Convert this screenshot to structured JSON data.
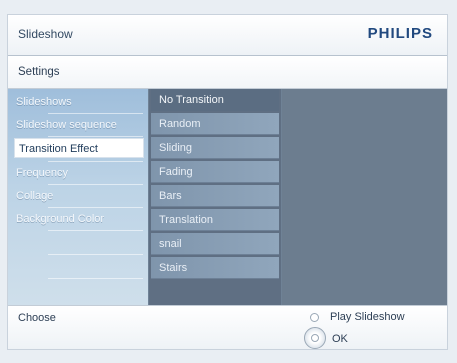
{
  "header": {
    "title": "Slideshow",
    "brand": "PHILIPS"
  },
  "settings": {
    "label": "Settings"
  },
  "menu": {
    "left_items": [
      {
        "label": "Slideshows"
      },
      {
        "label": "Slideshow sequence"
      },
      {
        "label": "Transition Effect",
        "selected": true
      },
      {
        "label": "Frequency"
      },
      {
        "label": "Collage"
      },
      {
        "label": "Background Color"
      }
    ],
    "transitions": [
      {
        "label": "No Transition",
        "highlighted": true
      },
      {
        "label": "Random"
      },
      {
        "label": "Sliding"
      },
      {
        "label": "Fading"
      },
      {
        "label": "Bars"
      },
      {
        "label": "Translation"
      },
      {
        "label": "snail"
      },
      {
        "label": "Stairs"
      }
    ]
  },
  "footer": {
    "choose_label": "Choose",
    "play_label": "Play Slideshow",
    "ok_label": "OK"
  },
  "colors": {
    "brand": "#21497f",
    "menu_panel": "#6c7d8f",
    "selected_bg": "#ffffff"
  }
}
